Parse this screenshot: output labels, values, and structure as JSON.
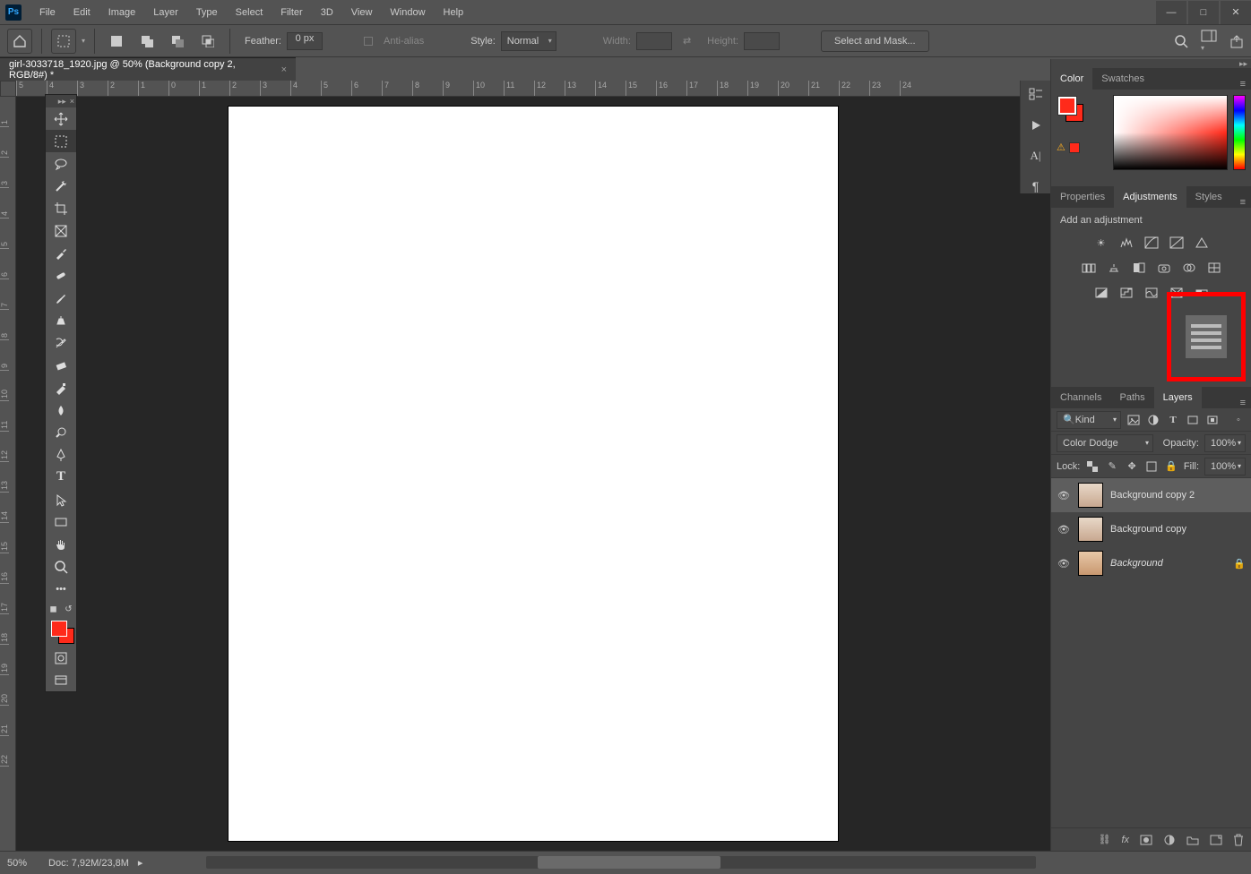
{
  "menu": {
    "items": [
      "File",
      "Edit",
      "Image",
      "Layer",
      "Type",
      "Select",
      "Filter",
      "3D",
      "View",
      "Window",
      "Help"
    ]
  },
  "optionsbar": {
    "feather_label": "Feather:",
    "feather_value": "0 px",
    "antialias_label": "Anti-alias",
    "style_label": "Style:",
    "style_value": "Normal",
    "width_label": "Width:",
    "height_label": "Height:",
    "selectmask_label": "Select and Mask..."
  },
  "document_tab": {
    "title": "girl-3033718_1920.jpg @ 50% (Background copy 2, RGB/8#) *"
  },
  "ruler_h": [
    "5",
    "4",
    "3",
    "2",
    "1",
    "0",
    "1",
    "2",
    "3",
    "4",
    "5",
    "6",
    "7",
    "8",
    "9",
    "10",
    "11",
    "12",
    "13",
    "14",
    "15",
    "16",
    "17",
    "18",
    "19",
    "20",
    "21",
    "22",
    "23",
    "24"
  ],
  "ruler_v": [
    "1",
    "2",
    "3",
    "4",
    "5",
    "6",
    "7",
    "8",
    "9",
    "10",
    "11",
    "12",
    "13",
    "14",
    "15",
    "16",
    "17",
    "18",
    "19",
    "20",
    "21",
    "22"
  ],
  "panels": {
    "color_tab": "Color",
    "swatches_tab": "Swatches",
    "properties_tab": "Properties",
    "adjustments_tab": "Adjustments",
    "styles_tab": "Styles",
    "adjustments_hint": "Add an adjustment",
    "channels_tab": "Channels",
    "paths_tab": "Paths",
    "layers_tab": "Layers"
  },
  "layers": {
    "filter_prefix": "Kind",
    "blend_mode": "Color Dodge",
    "opacity_label": "Opacity:",
    "opacity_value": "100%",
    "lock_label": "Lock:",
    "fill_label": "Fill:",
    "fill_value": "100%",
    "items": [
      {
        "name": "Background copy 2",
        "locked": false
      },
      {
        "name": "Background copy",
        "locked": false
      },
      {
        "name": "Background",
        "locked": true
      }
    ]
  },
  "status": {
    "zoom": "50%",
    "docinfo": "Doc: 7,92M/23,8M"
  },
  "colors": {
    "foreground": "#ff2a1a",
    "background": "#ff2a1a",
    "highlight": "#ff0000"
  }
}
